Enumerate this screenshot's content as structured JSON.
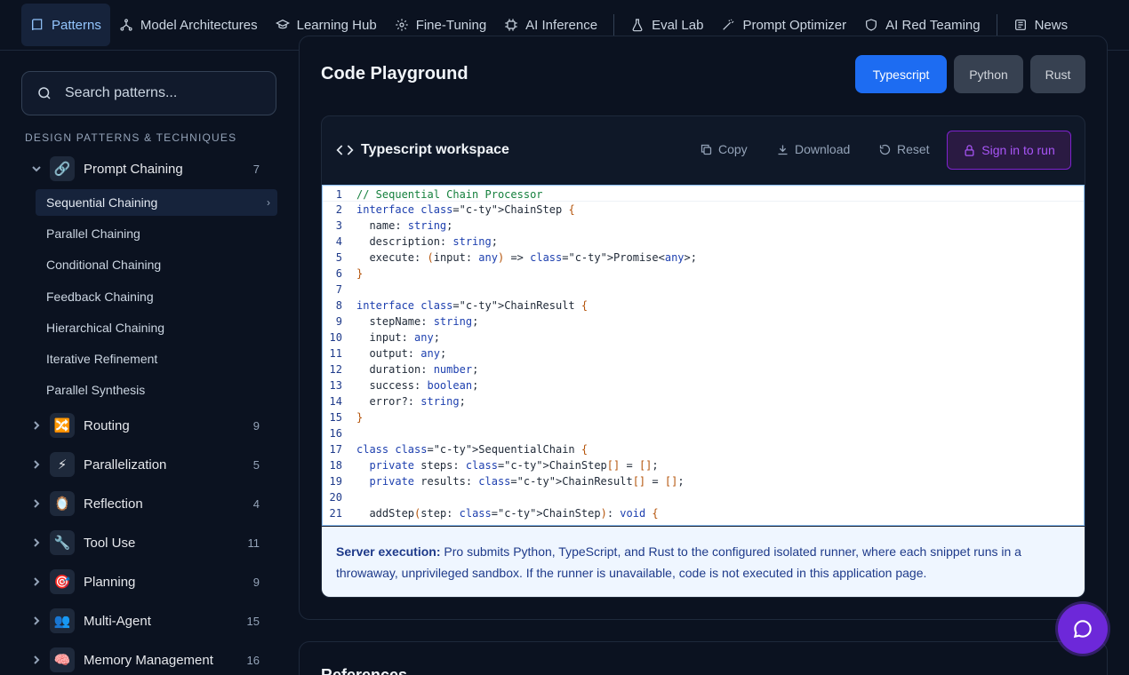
{
  "nav": {
    "items": [
      {
        "label": "Patterns",
        "icon": "book-icon",
        "active": true
      },
      {
        "label": "Model Architectures",
        "icon": "network-icon"
      },
      {
        "label": "Learning Hub",
        "icon": "graduation-cap-icon"
      },
      {
        "label": "Fine-Tuning",
        "icon": "gear-icon"
      },
      {
        "label": "AI Inference",
        "icon": "cpu-icon"
      },
      {
        "label": "Eval Lab",
        "icon": "flask-icon"
      },
      {
        "label": "Prompt Optimizer",
        "icon": "wand-icon"
      },
      {
        "label": "AI Red Teaming",
        "icon": "shield-icon"
      },
      {
        "label": "News",
        "icon": "newspaper-icon"
      }
    ]
  },
  "sidebar": {
    "search_placeholder": "Search patterns...",
    "section_title": "DESIGN PATTERNS & TECHNIQUES",
    "groups": [
      {
        "label": "Prompt Chaining",
        "count": "7",
        "icon": "🔗",
        "expanded": true
      },
      {
        "label": "Routing",
        "count": "9",
        "icon": "🔀"
      },
      {
        "label": "Parallelization",
        "count": "5",
        "icon": "⚡"
      },
      {
        "label": "Reflection",
        "count": "4",
        "icon": "🪞"
      },
      {
        "label": "Tool Use",
        "count": "11",
        "icon": "🔧"
      },
      {
        "label": "Planning",
        "count": "9",
        "icon": "🎯"
      },
      {
        "label": "Multi-Agent",
        "count": "15",
        "icon": "👥"
      },
      {
        "label": "Memory Management",
        "count": "16",
        "icon": "🧠"
      }
    ],
    "sub_items": [
      {
        "label": "Sequential Chaining",
        "active": true
      },
      {
        "label": "Parallel Chaining"
      },
      {
        "label": "Conditional Chaining"
      },
      {
        "label": "Feedback Chaining"
      },
      {
        "label": "Hierarchical Chaining"
      },
      {
        "label": "Iterative Refinement"
      },
      {
        "label": "Parallel Synthesis"
      }
    ]
  },
  "main": {
    "title": "Code Playground",
    "languages": [
      "Typescript",
      "Python",
      "Rust"
    ],
    "selected_language": "Typescript",
    "workspace": {
      "title": "Typescript workspace",
      "copy_label": "Copy",
      "download_label": "Download",
      "reset_label": "Reset",
      "run_label": "Sign in to run"
    },
    "code_lines": [
      "// Sequential Chain Processor",
      "interface ChainStep {",
      "  name: string;",
      "  description: string;",
      "  execute: (input: any) => Promise<any>;",
      "}",
      "",
      "interface ChainResult {",
      "  stepName: string;",
      "  input: any;",
      "  output: any;",
      "  duration: number;",
      "  success: boolean;",
      "  error?: string;",
      "}",
      "",
      "class SequentialChain {",
      "  private steps: ChainStep[] = [];",
      "  private results: ChainResult[] = [];",
      "",
      "  addStep(step: ChainStep): void {"
    ],
    "notice_bold": "Server execution:",
    "notice_text": " Pro submits Python, TypeScript, and Rust to the configured isolated runner, where each snippet runs in a throwaway, unprivileged sandbox. If the runner is unavailable, code is not executed in this application page.",
    "references_title": "References"
  }
}
